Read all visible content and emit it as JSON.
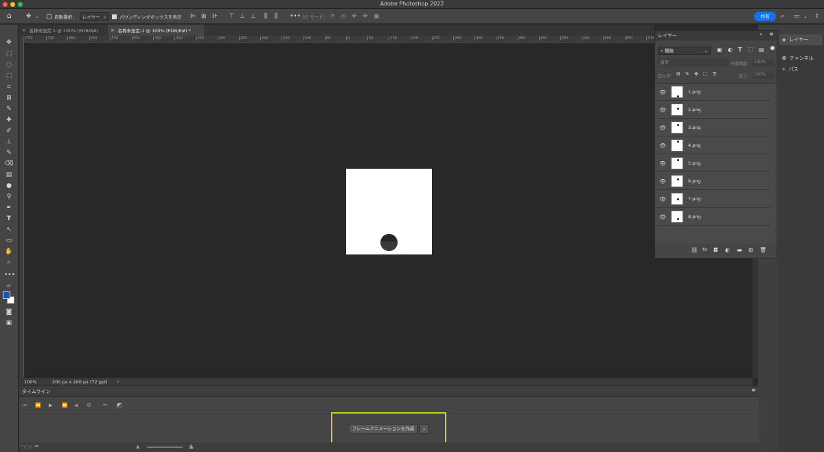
{
  "app": {
    "title": "Adobe Photoshop 2022"
  },
  "options_bar": {
    "auto_select_label": "自動選択：",
    "auto_select_target": "レイヤー",
    "show_bbox_label": "バウンディングボックスを表示",
    "mode_3d_label": "3D モード：",
    "share_label": "共有"
  },
  "tabs": [
    {
      "label": "名称未設定 1 @ 100% (RGB/8#)"
    },
    {
      "label": "名称未設定-1 @ 100% (RGB/8#) *"
    }
  ],
  "ruler_ticks": [
    "750",
    "700",
    "650",
    "600",
    "550",
    "500",
    "450",
    "400",
    "350",
    "300",
    "250",
    "200",
    "150",
    "100",
    "50",
    "0",
    "50",
    "100",
    "150",
    "200",
    "250",
    "300",
    "350",
    "400",
    "450",
    "500",
    "550",
    "600",
    "650",
    "700",
    "750",
    "800",
    "850"
  ],
  "status": {
    "zoom": "100%",
    "doc_info": "200 px x 200 px (72 ppi)"
  },
  "layers_panel": {
    "tab_label": "レイヤー",
    "filter_kind": "種類",
    "blend_mode": "通常",
    "opacity_label": "不透明度：",
    "opacity_value": "100%",
    "lock_label": "ロック：",
    "fill_label": "塗り：",
    "fill_value": "100%",
    "layers": [
      {
        "name": "1.png"
      },
      {
        "name": "2.png"
      },
      {
        "name": "3.png"
      },
      {
        "name": "4.png"
      },
      {
        "name": "5.png"
      },
      {
        "name": "6.png"
      },
      {
        "name": "7.png"
      },
      {
        "name": "8.png"
      }
    ]
  },
  "dock": {
    "layers": "レイヤー",
    "channels": "チャンネル",
    "paths": "パス"
  },
  "timeline": {
    "title": "タイムライン",
    "create_frame_animation": "フレームアニメーションを作成"
  },
  "colors": {
    "foreground": "#1a4fbf",
    "background": "#ffffff",
    "accent": "#1473e6",
    "highlight": "#d3d21a"
  }
}
